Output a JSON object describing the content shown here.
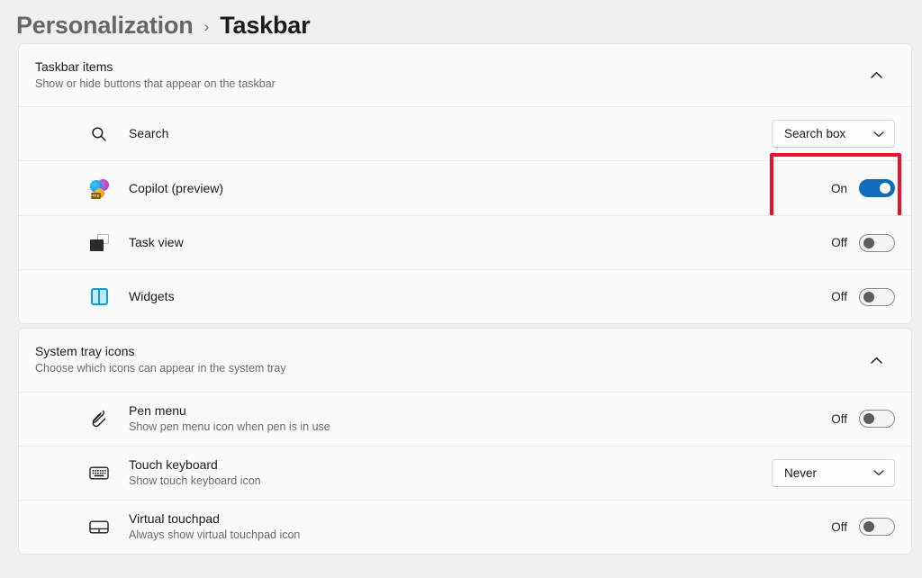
{
  "breadcrumb": {
    "parent": "Personalization",
    "separator": "›",
    "current": "Taskbar"
  },
  "sections": [
    {
      "title": "Taskbar items",
      "subtitle": "Show or hide buttons that appear on the taskbar",
      "collapse_icon": "chevron-up-icon",
      "rows": [
        {
          "icon": "search-icon",
          "label": "Search",
          "sub": "",
          "control": "dropdown",
          "value": "Search box",
          "highlighted": false
        },
        {
          "icon": "copilot-icon",
          "label": "Copilot (preview)",
          "sub": "",
          "control": "toggle",
          "value": "On",
          "toggle_on": true,
          "highlighted": true
        },
        {
          "icon": "task-view-icon",
          "label": "Task view",
          "sub": "",
          "control": "toggle",
          "value": "Off",
          "toggle_on": false,
          "highlighted": false
        },
        {
          "icon": "widgets-icon",
          "label": "Widgets",
          "sub": "",
          "control": "toggle",
          "value": "Off",
          "toggle_on": false,
          "highlighted": false
        }
      ]
    },
    {
      "title": "System tray icons",
      "subtitle": "Choose which icons can appear in the system tray",
      "collapse_icon": "chevron-up-icon",
      "rows": [
        {
          "icon": "pen-icon",
          "label": "Pen menu",
          "sub": "Show pen menu icon when pen is in use",
          "control": "toggle",
          "value": "Off",
          "toggle_on": false,
          "highlighted": false
        },
        {
          "icon": "keyboard-icon",
          "label": "Touch keyboard",
          "sub": "Show touch keyboard icon",
          "control": "dropdown",
          "value": "Never",
          "highlighted": false
        },
        {
          "icon": "touchpad-icon",
          "label": "Virtual touchpad",
          "sub": "Always show virtual touchpad icon",
          "control": "toggle",
          "value": "Off",
          "toggle_on": false,
          "highlighted": false
        }
      ]
    }
  ],
  "colors": {
    "accent": "#0f6cbd",
    "highlight": "#e8132a",
    "page_background": "#f0f0f0",
    "card_background": "#fbfbfb"
  }
}
